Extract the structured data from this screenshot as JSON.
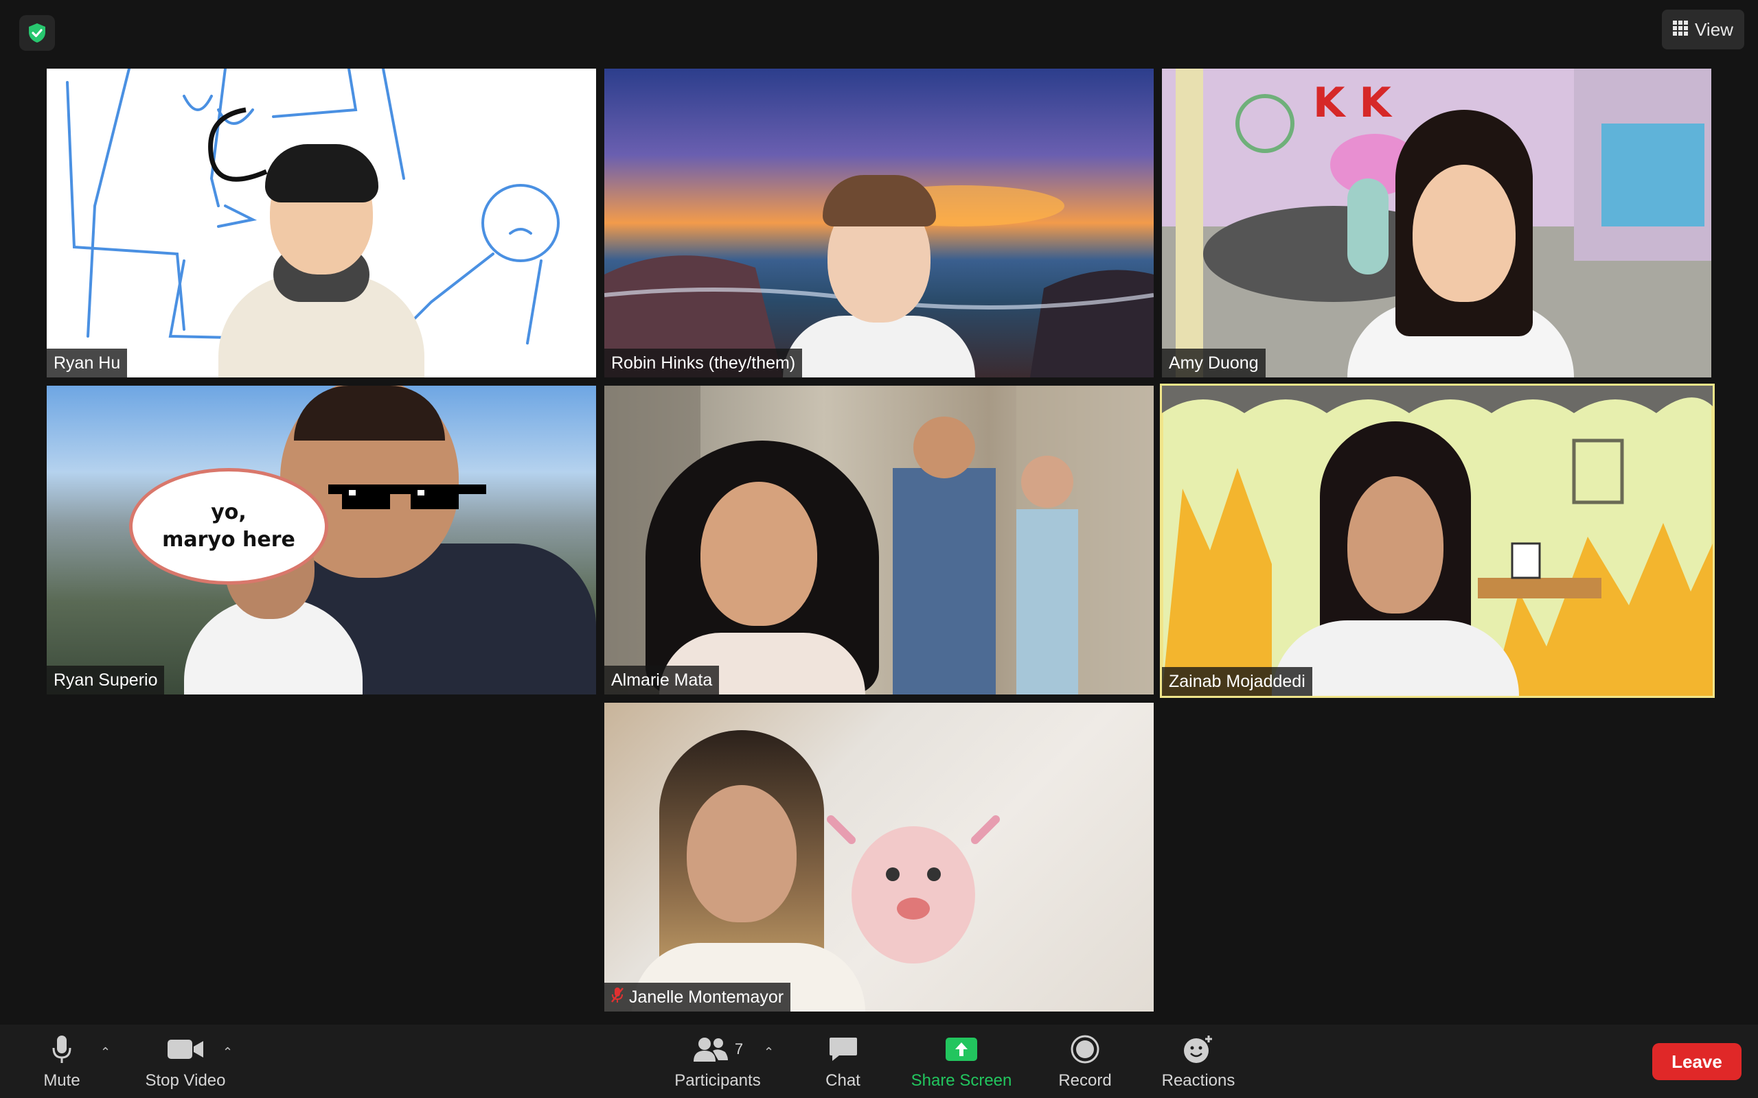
{
  "top_bar": {
    "security_icon": "shield-check-icon",
    "view_label": "View",
    "view_icon": "grid-icon"
  },
  "participants_tiles": [
    {
      "name": "Ryan Hu"
    },
    {
      "name": "Robin Hinks (they/them)"
    },
    {
      "name": "Amy Duong"
    },
    {
      "name": "Ryan Superio",
      "speech_bubble": "yo,\nmaryo here"
    },
    {
      "name": "Almarie Mata"
    },
    {
      "name": "Zainab Mojaddedi",
      "active_speaker": true
    },
    {
      "name": "Janelle Montemayor",
      "muted": true
    }
  ],
  "toolbar": {
    "mute_label": "Mute",
    "stop_video_label": "Stop Video",
    "participants_label": "Participants",
    "participants_count": "7",
    "chat_label": "Chat",
    "share_screen_label": "Share Screen",
    "record_label": "Record",
    "reactions_label": "Reactions",
    "leave_label": "Leave"
  },
  "colors": {
    "background": "#141414",
    "toolbar": "#1c1c1c",
    "share_screen": "#22c55e",
    "leave": "#e02828",
    "active_speaker_border": "#f0e58a",
    "security_shield": "#28c76f"
  }
}
